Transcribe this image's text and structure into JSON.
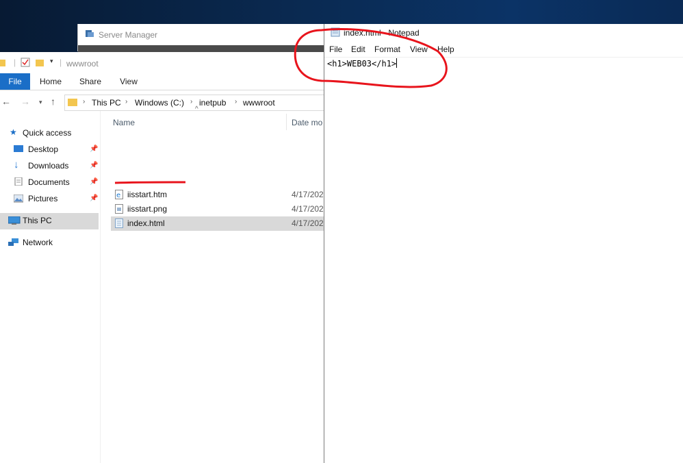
{
  "server_manager": {
    "title": "Server Manager"
  },
  "explorer": {
    "window_title": "wwwroot",
    "ribbon_tabs": [
      "File",
      "Home",
      "Share",
      "View"
    ],
    "address": [
      "This PC",
      "Windows (C:)",
      "inetpub",
      "wwwroot"
    ],
    "nav": [
      {
        "label": "Quick access",
        "icon": "star-icon"
      },
      {
        "label": "Desktop",
        "icon": "desktop-folder-icon",
        "pinned": true
      },
      {
        "label": "Downloads",
        "icon": "download-arrow-icon",
        "pinned": true
      },
      {
        "label": "Documents",
        "icon": "documents-icon",
        "pinned": true
      },
      {
        "label": "Pictures",
        "icon": "pictures-icon",
        "pinned": true
      },
      {
        "label": "This PC",
        "icon": "computer-icon",
        "selected": true
      },
      {
        "label": "Network",
        "icon": "network-icon"
      }
    ],
    "columns": {
      "name": "Name",
      "date": "Date mo"
    },
    "files": [
      {
        "name": "iisstart.htm",
        "date": "4/17/202",
        "icon": "ie-document-icon"
      },
      {
        "name": "iisstart.png",
        "date": "4/17/202",
        "icon": "image-file-icon"
      },
      {
        "name": "index.html",
        "date": "4/17/202",
        "icon": "html-file-icon",
        "selected": true
      }
    ]
  },
  "notepad": {
    "title": "index.html - Notepad",
    "menu": [
      "File",
      "Edit",
      "Format",
      "View",
      "Help"
    ],
    "content": "<h1>WEB03</h1>"
  },
  "colors": {
    "annotation": "#e8141c",
    "ribbon_file": "#1a6ec7",
    "selection": "#d9d9d9"
  }
}
